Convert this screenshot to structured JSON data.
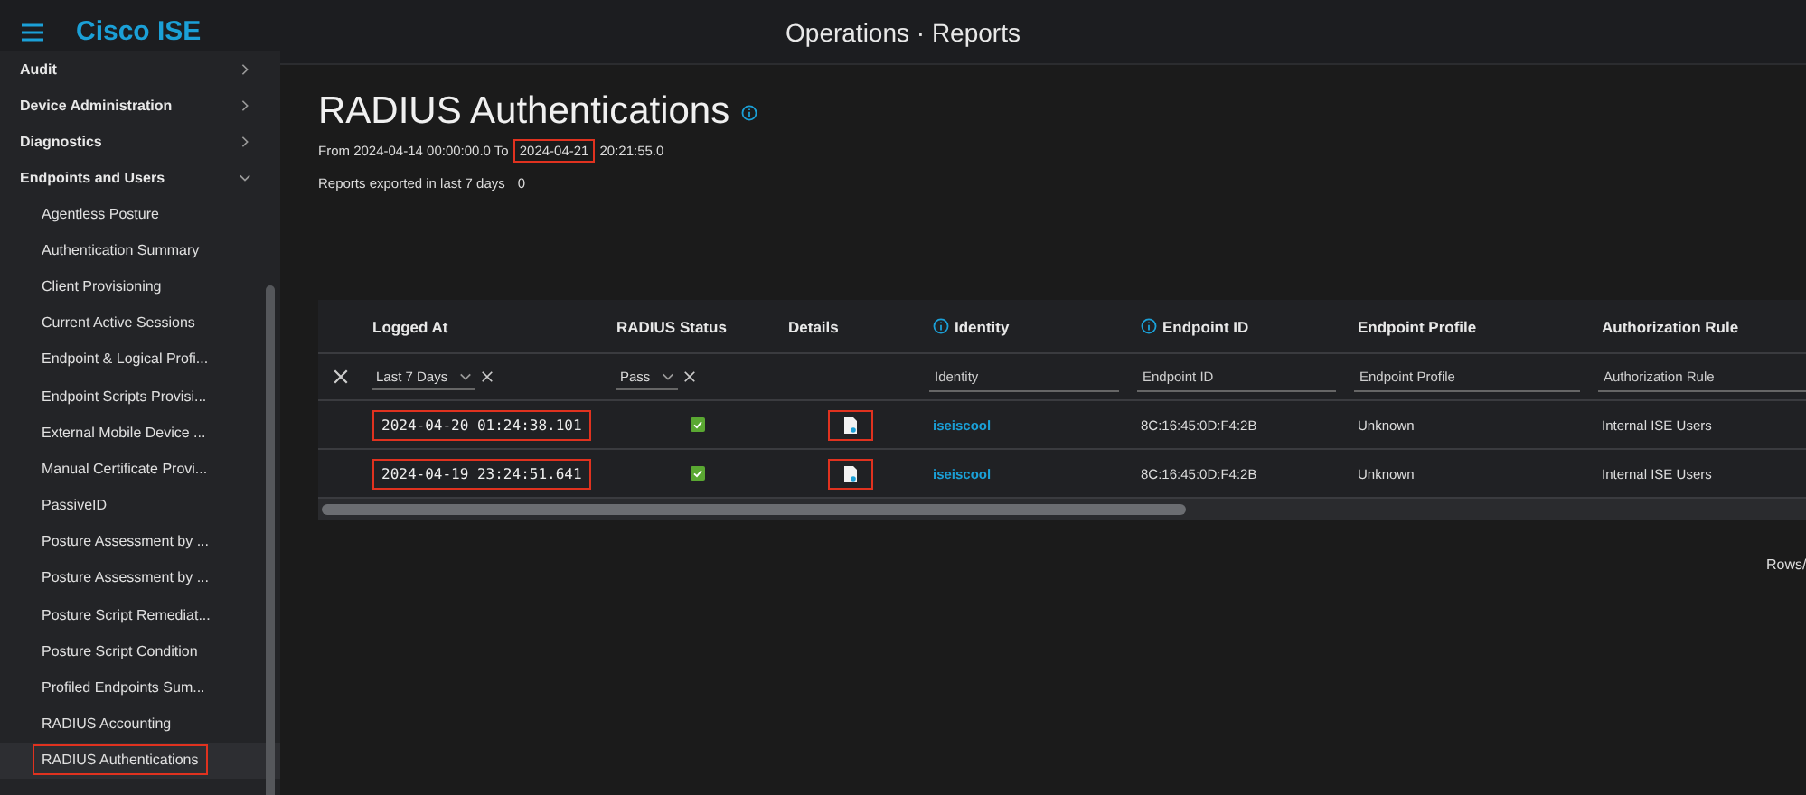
{
  "header": {
    "brand": "Cisco ISE",
    "title": "Operations · Reports"
  },
  "sidebar": {
    "items": [
      {
        "label": "Audit",
        "expanded": false
      },
      {
        "label": "Device Administration",
        "expanded": false
      },
      {
        "label": "Diagnostics",
        "expanded": false
      },
      {
        "label": "Endpoints and Users",
        "expanded": true,
        "children": [
          {
            "label": "Agentless Posture",
            "selected": false,
            "highlighted": false
          },
          {
            "label": "Authentication Summary",
            "selected": false,
            "highlighted": false
          },
          {
            "label": "Client Provisioning",
            "selected": false,
            "highlighted": false
          },
          {
            "label": "Current Active Sessions",
            "selected": false,
            "highlighted": false
          },
          {
            "label": "Endpoint & Logical Profi...",
            "selected": false,
            "highlighted": false
          },
          {
            "label": "Endpoint Scripts Provisi...",
            "selected": false,
            "highlighted": false
          },
          {
            "label": "External Mobile Device ...",
            "selected": false,
            "highlighted": false
          },
          {
            "label": "Manual Certificate Provi...",
            "selected": false,
            "highlighted": false
          },
          {
            "label": "PassiveID",
            "selected": false,
            "highlighted": false
          },
          {
            "label": "Posture Assessment by ...",
            "selected": false,
            "highlighted": false
          },
          {
            "label": "Posture Assessment by ...",
            "selected": false,
            "highlighted": false
          },
          {
            "label": "Posture Script Remediat...",
            "selected": false,
            "highlighted": false
          },
          {
            "label": "Posture Script Condition",
            "selected": false,
            "highlighted": false
          },
          {
            "label": "Profiled Endpoints Sum...",
            "selected": false,
            "highlighted": false
          },
          {
            "label": "RADIUS Accounting",
            "selected": false,
            "highlighted": false
          },
          {
            "label": "RADIUS Authentications",
            "selected": true,
            "highlighted": true
          }
        ]
      }
    ]
  },
  "report": {
    "title": "RADIUS Authentications",
    "range_from": "From 2024-04-14 00:00:00.0 To",
    "range_to_date": "2024-04-21",
    "range_to_time": "20:21:55.0",
    "range_to_highlighted": true,
    "exports_label": "Reports exported in last 7 days",
    "exports_count": "0"
  },
  "table": {
    "columns": [
      {
        "label": "Logged At",
        "info": false,
        "filter": {
          "kind": "select",
          "value": "Last 7 Days"
        }
      },
      {
        "label": "RADIUS Status",
        "info": false,
        "filter": {
          "kind": "select",
          "value": "Pass"
        }
      },
      {
        "label": "Details",
        "info": false,
        "filter": {
          "kind": "none"
        }
      },
      {
        "label": "Identity",
        "info": true,
        "filter": {
          "kind": "text",
          "placeholder": "Identity"
        }
      },
      {
        "label": "Endpoint ID",
        "info": true,
        "filter": {
          "kind": "text",
          "placeholder": "Endpoint ID"
        }
      },
      {
        "label": "Endpoint Profile",
        "info": false,
        "filter": {
          "kind": "text",
          "placeholder": "Endpoint Profile"
        }
      },
      {
        "label": "Authorization Rule",
        "info": false,
        "filter": {
          "kind": "text",
          "placeholder": "Authorization Rule"
        }
      }
    ],
    "rows": [
      {
        "logged_at": "2024-04-20 01:24:38.101",
        "status_pass": true,
        "identity": "iseiscool",
        "endpoint_id": "8C:16:45:0D:F4:2B",
        "endpoint_profile": "Unknown",
        "authorization_rule": "Internal ISE Users",
        "highlighted": true
      },
      {
        "logged_at": "2024-04-19 23:24:51.641",
        "status_pass": true,
        "identity": "iseiscool",
        "endpoint_id": "8C:16:45:0D:F4:2B",
        "endpoint_profile": "Unknown",
        "authorization_rule": "Internal ISE Users",
        "highlighted": true
      }
    ],
    "footer_label": "Rows/"
  }
}
